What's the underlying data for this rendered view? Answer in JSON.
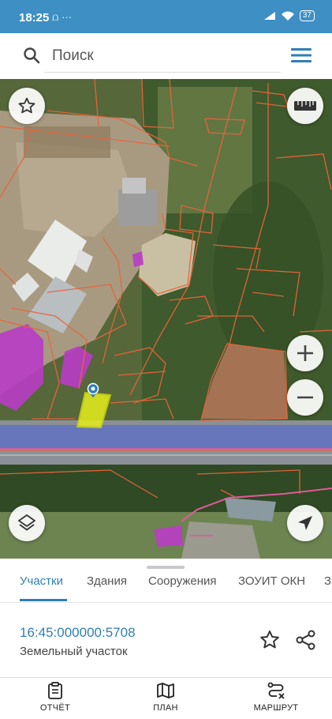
{
  "status_bar": {
    "time": "18:25",
    "left_icons": "⩍ ···",
    "battery": "37",
    "icons": [
      "signal-icon",
      "wifi-icon",
      "battery-icon"
    ]
  },
  "search": {
    "placeholder": "Поиск"
  },
  "map": {
    "background": "satellite",
    "parcel_highlight_color": "#e6ef1a",
    "boundary_color": "#e8643c",
    "zone_color": "#b93cc6",
    "road_overlay_color": "#4b5fd8"
  },
  "tabs": [
    {
      "label": "Участки",
      "active": true
    },
    {
      "label": "Здания",
      "active": false
    },
    {
      "label": "Сооружения",
      "active": false
    },
    {
      "label": "ЗОУИТ ОКН",
      "active": false
    },
    {
      "label": "З",
      "active": false
    }
  ],
  "parcel": {
    "number": "16:45:000000:5708",
    "type": "Земельный участок"
  },
  "bottom_nav": [
    {
      "label": "ОТЧЁТ",
      "icon": "report-icon"
    },
    {
      "label": "ПЛАН",
      "icon": "map-plan-icon"
    },
    {
      "label": "МАРШРУТ",
      "icon": "route-icon"
    }
  ],
  "colors": {
    "accent": "#2f7fb3",
    "status_bar": "#3d8fc4"
  }
}
